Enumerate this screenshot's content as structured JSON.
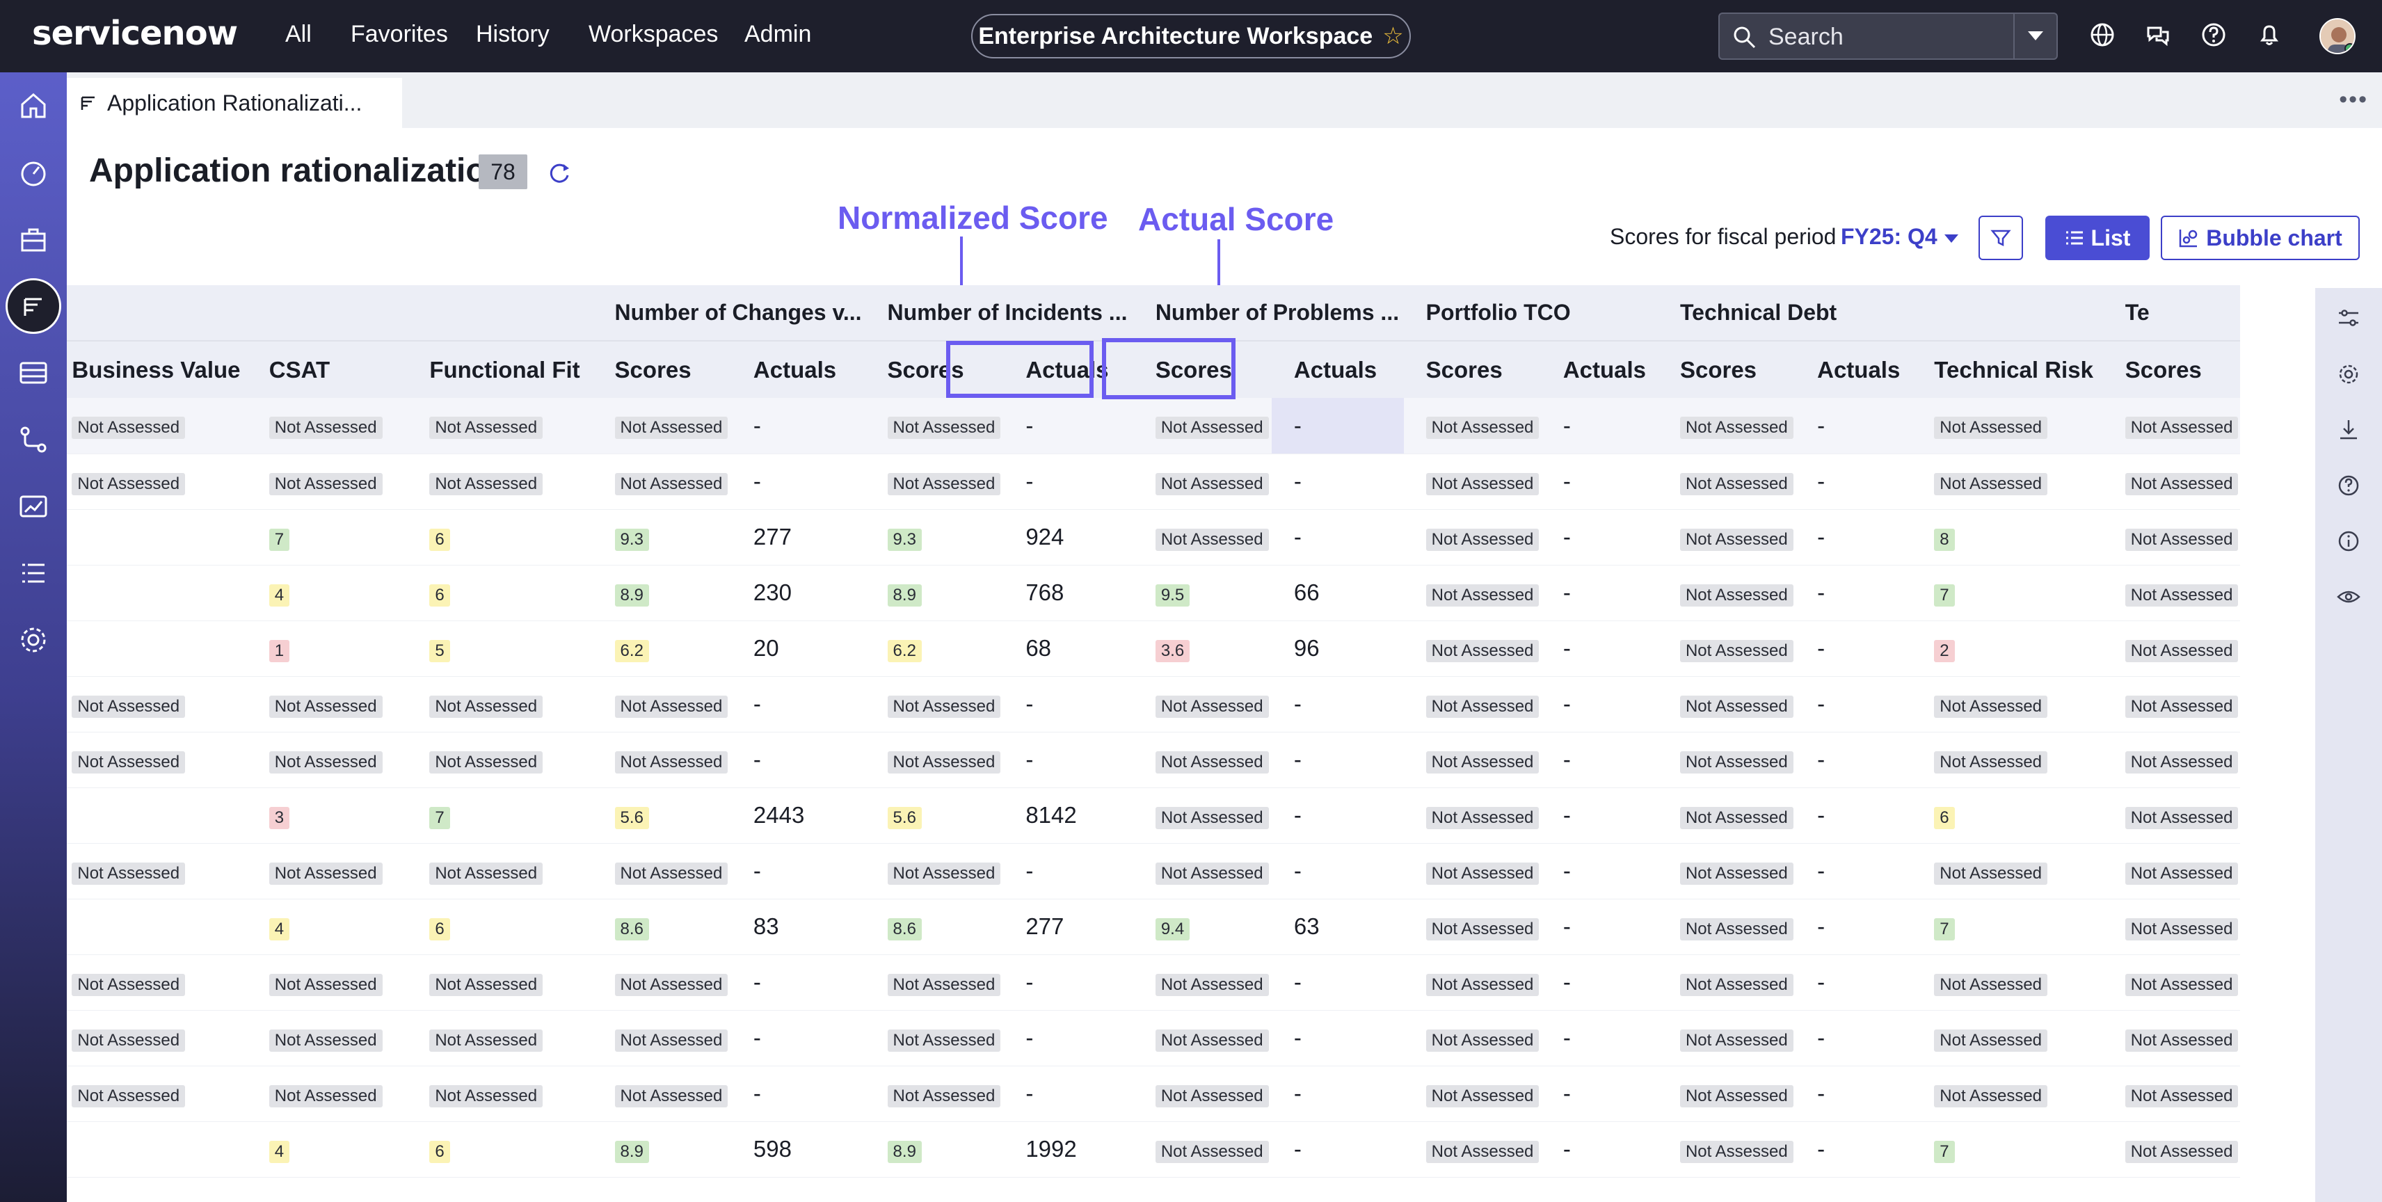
{
  "brand": {
    "logo_text": "servicenow"
  },
  "nav": {
    "links": [
      "All",
      "Favorites",
      "History",
      "Workspaces",
      "Admin"
    ]
  },
  "workspace_title": "Enterprise Architecture Workspace",
  "search": {
    "placeholder": "Search"
  },
  "tab": {
    "label": "Application Rationalizati..."
  },
  "page": {
    "title": "Application rationalization",
    "count": "78"
  },
  "annotations": {
    "normalized": "Normalized Score",
    "actual": "Actual Score"
  },
  "fiscal": {
    "label": "Scores for fiscal period",
    "value": "FY25: Q4"
  },
  "buttons": {
    "list": "List",
    "bubble_chart": "Bubble chart"
  },
  "table": {
    "group_headers": [
      "",
      "",
      "",
      "",
      "Number of Changes v...",
      "Number of Incidents ...",
      "Number of Problems ...",
      "Portfolio TCO",
      "Technical Debt",
      "",
      "Te"
    ],
    "sub_headers": [
      "",
      "Business Value",
      "CSAT",
      "Functional Fit",
      "Scores",
      "Actuals",
      "Scores",
      "Actuals",
      "Scores",
      "Actuals",
      "Scores",
      "Actuals",
      "Scores",
      "Actuals",
      "Technical Risk",
      "Scores"
    ],
    "rows": [
      [
        "Not Assessed",
        "Not Assessed",
        "Not Assessed",
        "Not Assessed",
        "-",
        "Not Assessed",
        "-",
        "Not Assessed",
        "-",
        "Not Assessed",
        "-",
        "Not Assessed",
        "-",
        "Not Assessed",
        "Not Assessed"
      ],
      [
        "Not Assessed",
        "Not Assessed",
        "Not Assessed",
        "Not Assessed",
        "-",
        "Not Assessed",
        "-",
        "Not Assessed",
        "-",
        "Not Assessed",
        "-",
        "Not Assessed",
        "-",
        "Not Assessed",
        "Not Assessed"
      ],
      [
        "",
        "7",
        "6",
        "9.3",
        "277",
        "9.3",
        "924",
        "Not Assessed",
        "-",
        "Not Assessed",
        "-",
        "Not Assessed",
        "-",
        "8",
        "Not Assessed"
      ],
      [
        "",
        "4",
        "6",
        "8.9",
        "230",
        "8.9",
        "768",
        "9.5",
        "66",
        "Not Assessed",
        "-",
        "Not Assessed",
        "-",
        "7",
        "Not Assessed"
      ],
      [
        "",
        "1",
        "5",
        "6.2",
        "20",
        "6.2",
        "68",
        "3.6",
        "96",
        "Not Assessed",
        "-",
        "Not Assessed",
        "-",
        "2",
        "Not Assessed"
      ],
      [
        "Not Assessed",
        "Not Assessed",
        "Not Assessed",
        "Not Assessed",
        "-",
        "Not Assessed",
        "-",
        "Not Assessed",
        "-",
        "Not Assessed",
        "-",
        "Not Assessed",
        "-",
        "Not Assessed",
        "Not Assessed"
      ],
      [
        "Not Assessed",
        "Not Assessed",
        "Not Assessed",
        "Not Assessed",
        "-",
        "Not Assessed",
        "-",
        "Not Assessed",
        "-",
        "Not Assessed",
        "-",
        "Not Assessed",
        "-",
        "Not Assessed",
        "Not Assessed"
      ],
      [
        "",
        "3",
        "7",
        "5.6",
        "2443",
        "5.6",
        "8142",
        "Not Assessed",
        "-",
        "Not Assessed",
        "-",
        "Not Assessed",
        "-",
        "6",
        "Not Assessed"
      ],
      [
        "Not Assessed",
        "Not Assessed",
        "Not Assessed",
        "Not Assessed",
        "-",
        "Not Assessed",
        "-",
        "Not Assessed",
        "-",
        "Not Assessed",
        "-",
        "Not Assessed",
        "-",
        "Not Assessed",
        "Not Assessed"
      ],
      [
        "",
        "4",
        "6",
        "8.6",
        "83",
        "8.6",
        "277",
        "9.4",
        "63",
        "Not Assessed",
        "-",
        "Not Assessed",
        "-",
        "7",
        "Not Assessed"
      ],
      [
        "Not Assessed",
        "Not Assessed",
        "Not Assessed",
        "Not Assessed",
        "-",
        "Not Assessed",
        "-",
        "Not Assessed",
        "-",
        "Not Assessed",
        "-",
        "Not Assessed",
        "-",
        "Not Assessed",
        "Not Assessed"
      ],
      [
        "Not Assessed",
        "Not Assessed",
        "Not Assessed",
        "Not Assessed",
        "-",
        "Not Assessed",
        "-",
        "Not Assessed",
        "-",
        "Not Assessed",
        "-",
        "Not Assessed",
        "-",
        "Not Assessed",
        "Not Assessed"
      ],
      [
        "Not Assessed",
        "Not Assessed",
        "Not Assessed",
        "Not Assessed",
        "-",
        "Not Assessed",
        "-",
        "Not Assessed",
        "-",
        "Not Assessed",
        "-",
        "Not Assessed",
        "-",
        "Not Assessed",
        "Not Assessed"
      ],
      [
        "",
        "4",
        "6",
        "8.9",
        "598",
        "8.9",
        "1992",
        "Not Assessed",
        "-",
        "Not Assessed",
        "-",
        "Not Assessed",
        "-",
        "7",
        "Not Assessed"
      ]
    ]
  },
  "score_colors": {
    "na": "#e1e2e6",
    "green": "#cfe9c7",
    "yellow": "#fbf3b5",
    "red": "#f6cfd2"
  },
  "accent": "#3c3fc8",
  "annotation_color": "#6b5cf0"
}
